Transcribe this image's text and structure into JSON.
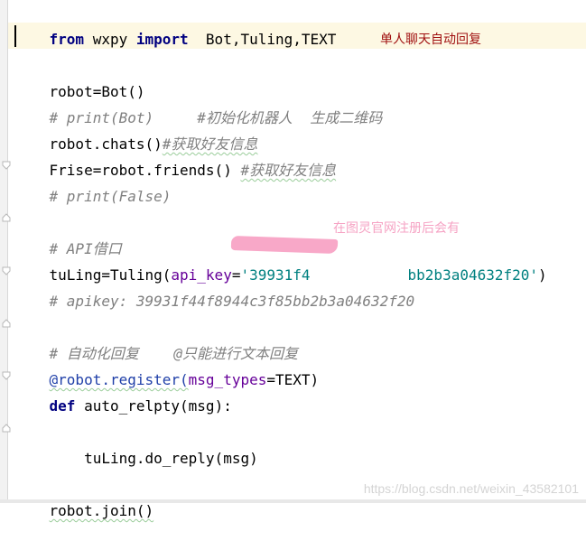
{
  "editor": {
    "lines": {
      "l1": {
        "kw1": "from",
        "mod": " wxpy ",
        "kw2": "import",
        "names": "  Bot,Tuling,TEXT"
      },
      "l3": {
        "text": "robot=Bot()"
      },
      "l4": {
        "comment": "# print(Bot)     #初始化机器人  生成二维码"
      },
      "l5": {
        "code": "robot.chats()",
        "comment": "#获取好友信息"
      },
      "l6": {
        "code": "Frise=robot.friends() ",
        "comment": "#获取好友信息"
      },
      "l7": {
        "comment": "# print(False)"
      },
      "l9": {
        "comment": "# API借口"
      },
      "l10": {
        "code1": "tuLing=Tuling(",
        "param": "api_key",
        "eq": "=",
        "str_start": "'39931f4",
        "str_end": "bb2b3a04632f20'",
        "close": ")"
      },
      "l11": {
        "comment": "# apikey: 39931f44f8944c3f85bb2b3a04632f20"
      },
      "l13": {
        "comment": "# 自动化回复    @只能进行文本回复"
      },
      "l14": {
        "deco": "@robot.register(",
        "param": "msg_types",
        "rest": "=TEXT)"
      },
      "l15": {
        "kw": "def",
        "rest": " auto_relpty(msg):"
      },
      "l17": {
        "text": "    tuLing.do_reply(msg)"
      },
      "l19": {
        "text": "robot.join()"
      }
    }
  },
  "annotations": {
    "title_note": "单人聊天自动回复",
    "api_note": "在图灵官网注册后会有"
  },
  "watermark": "https://blog.csdn.net/weixin_43582101",
  "colors": {
    "keyword": "#000080",
    "comment": "#808080",
    "parameter": "#660099",
    "string": "#008080",
    "current_line": "#fdf8e3",
    "note_red": "#a01010",
    "note_pink": "#f6a3c4",
    "redaction": "#f8a8c8"
  }
}
